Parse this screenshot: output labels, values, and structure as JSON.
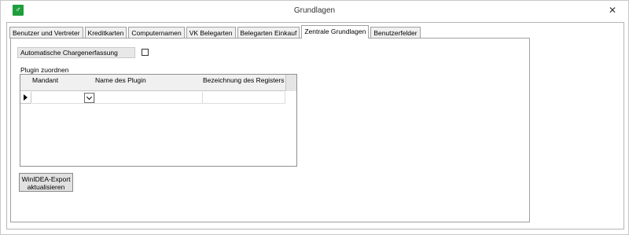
{
  "window": {
    "title": "Grundlagen",
    "close_symbol": "✕",
    "app_icon_name": "app-logo-icon"
  },
  "tabs": [
    {
      "label": "Benutzer und Vertreter",
      "active": false
    },
    {
      "label": "Kreditkarten",
      "active": false
    },
    {
      "label": "Computernamen",
      "active": false
    },
    {
      "label": "VK Belegarten",
      "active": false
    },
    {
      "label": "Belegarten Einkauf",
      "active": false
    },
    {
      "label": "Zentrale Grundlagen",
      "active": true
    },
    {
      "label": "Benutzerfelder",
      "active": false
    }
  ],
  "panel": {
    "auto_charge_label": "Automatische Chargenerfassung",
    "auto_charge_checked": false,
    "plugin_group_label": "Plugin zuordnen",
    "grid": {
      "columns": [
        "Mandant",
        "Name des Plugin",
        "Bezeichnung des Registers"
      ],
      "rows": [
        {
          "mandant": "",
          "plugin": "",
          "register": ""
        }
      ]
    },
    "export_button_line1": "WinIDEA-Export",
    "export_button_line2": "aktualisieren"
  }
}
